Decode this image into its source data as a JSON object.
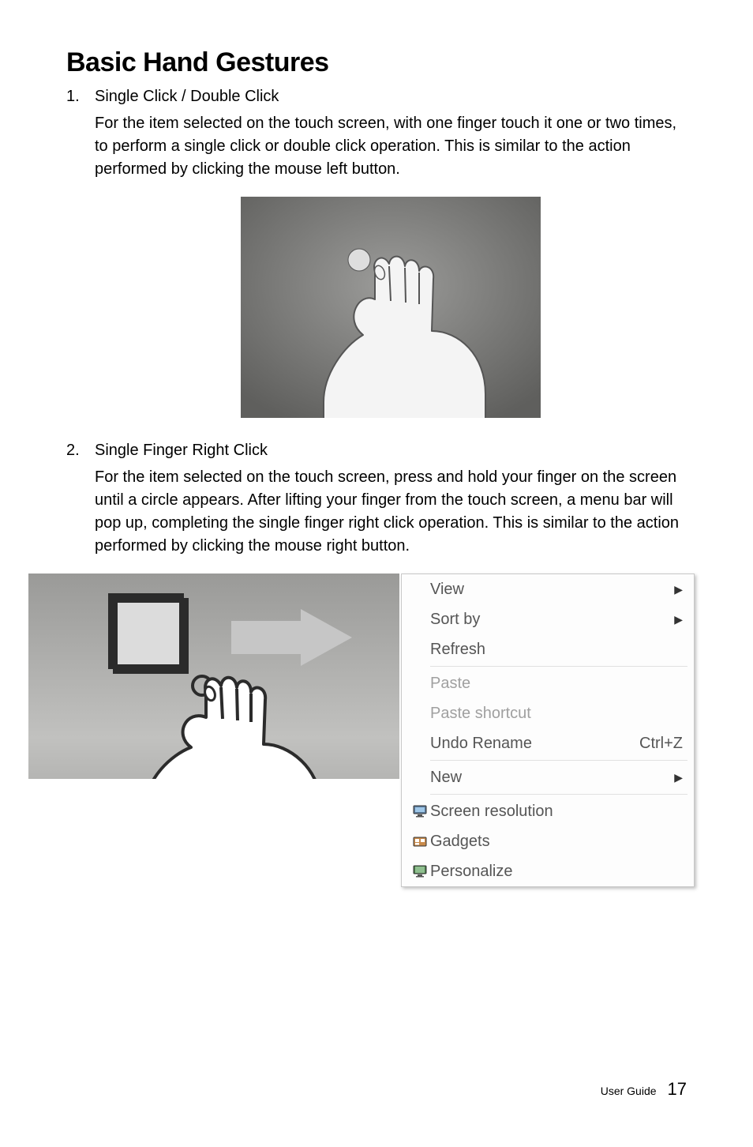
{
  "heading": "Basic Hand Gestures",
  "items": [
    {
      "title": "Single Click / Double Click",
      "body": "For the item selected on the touch screen, with one finger touch it one or two times, to perform a single click or double click operation. This is similar to the action performed by clicking the mouse left button."
    },
    {
      "title": "Single Finger Right Click",
      "body": "For the item selected on the touch screen, press and hold your finger on the screen until a circle appears. After lifting your finger from the touch screen, a menu bar will pop up, completing the single finger right click operation. This is similar to the action performed by clicking the mouse right button."
    }
  ],
  "context_menu": [
    {
      "label": "View",
      "submenu": true,
      "disabled": false,
      "icon": null,
      "shortcut": ""
    },
    {
      "label": "Sort by",
      "submenu": true,
      "disabled": false,
      "icon": null,
      "shortcut": ""
    },
    {
      "label": "Refresh",
      "submenu": false,
      "disabled": false,
      "icon": null,
      "shortcut": ""
    },
    {
      "sep": true
    },
    {
      "label": "Paste",
      "submenu": false,
      "disabled": true,
      "icon": null,
      "shortcut": ""
    },
    {
      "label": "Paste shortcut",
      "submenu": false,
      "disabled": true,
      "icon": null,
      "shortcut": ""
    },
    {
      "label": "Undo Rename",
      "submenu": false,
      "disabled": false,
      "icon": null,
      "shortcut": "Ctrl+Z"
    },
    {
      "sep": true
    },
    {
      "label": "New",
      "submenu": true,
      "disabled": false,
      "icon": null,
      "shortcut": ""
    },
    {
      "sep": true
    },
    {
      "label": "Screen resolution",
      "submenu": false,
      "disabled": false,
      "icon": "monitor-icon",
      "shortcut": ""
    },
    {
      "label": "Gadgets",
      "submenu": false,
      "disabled": false,
      "icon": "gadgets-icon",
      "shortcut": ""
    },
    {
      "label": "Personalize",
      "submenu": false,
      "disabled": false,
      "icon": "personalize-icon",
      "shortcut": ""
    }
  ],
  "footer": {
    "label": "User Guide",
    "page": "17"
  }
}
